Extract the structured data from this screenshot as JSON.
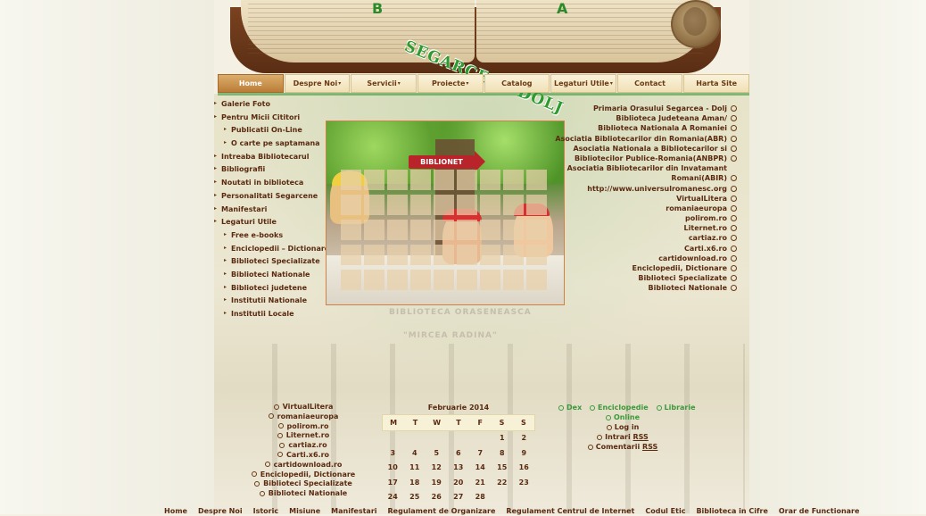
{
  "header": {
    "logo_text": "SEGARCEA - DOLJ",
    "book_left": "B",
    "book_right": "A"
  },
  "nav": [
    {
      "label": "Home",
      "active": true,
      "dropdown": false
    },
    {
      "label": "Despre Noi",
      "active": false,
      "dropdown": true
    },
    {
      "label": "Servicii",
      "active": false,
      "dropdown": true
    },
    {
      "label": "Proiecte",
      "active": false,
      "dropdown": true
    },
    {
      "label": "Catalog",
      "active": false,
      "dropdown": false
    },
    {
      "label": "Legaturi Utile",
      "active": false,
      "dropdown": true
    },
    {
      "label": "Contact",
      "active": false,
      "dropdown": false
    },
    {
      "label": "Harta Site",
      "active": false,
      "dropdown": false
    }
  ],
  "left_menu": [
    {
      "label": "Galerie Foto",
      "sub": false
    },
    {
      "label": "Pentru Micii Cititori",
      "sub": false
    },
    {
      "label": "Publicatii On-Line",
      "sub": true
    },
    {
      "label": "O carte pe saptamana",
      "sub": true
    },
    {
      "label": "Intreaba Bibliotecarul",
      "sub": false
    },
    {
      "label": "Bibliografii",
      "sub": false
    },
    {
      "label": "Noutati in biblioteca",
      "sub": false
    },
    {
      "label": "Personalitati Segarcene",
      "sub": false
    },
    {
      "label": "Manifestari",
      "sub": false
    },
    {
      "label": "Legaturi Utile",
      "sub": false
    },
    {
      "label": "Free e-books",
      "sub": true
    },
    {
      "label": "Enciclopedii – Dictionare",
      "sub": true
    },
    {
      "label": "Biblioteci Specializate",
      "sub": true
    },
    {
      "label": "Biblioteci Nationale",
      "sub": true
    },
    {
      "label": "Biblioteci judetene",
      "sub": true
    },
    {
      "label": "Institutii Nationale",
      "sub": true
    },
    {
      "label": "Institutii Locale",
      "sub": true
    }
  ],
  "photo": {
    "sign_text": "BIBLIONET"
  },
  "watermark": {
    "line1": "BIBLIOTECA ORASENEASCA",
    "line2": "\"MIRCEA RADINA\""
  },
  "right_links": [
    {
      "label": "Primaria Orasului Segarcea - Dolj",
      "bullet": true
    },
    {
      "label": "Biblioteca Judeteana Aman/",
      "bullet": true
    },
    {
      "label": "Biblioteca Nationala A Romaniei",
      "bullet": true
    },
    {
      "label": "Asociatia Bibliotecarilor din Romania(ABR)",
      "bullet": true
    },
    {
      "label": "Asociatia Nationala a Bibliotecarilor si",
      "bullet": true
    },
    {
      "label": "Bibliotecilor Publice-Romania(ANBPR)",
      "bullet": true
    },
    {
      "label": "Asociatia Bibliotecarilor din Invatamant",
      "bullet": false
    },
    {
      "label": "Romani(ABIR)",
      "bullet": true
    },
    {
      "label": "http://www.universulromanesc.org",
      "bullet": true
    },
    {
      "label": "VirtualLitera",
      "bullet": true
    },
    {
      "label": "romaniaeuropa",
      "bullet": true
    },
    {
      "label": "polirom.ro",
      "bullet": true
    },
    {
      "label": "Liternet.ro",
      "bullet": true
    },
    {
      "label": "cartiaz.ro",
      "bullet": true
    },
    {
      "label": "Carti.x6.ro",
      "bullet": true
    },
    {
      "label": "cartidownload.ro",
      "bullet": true
    },
    {
      "label": "Enciclopedii, Dictionare",
      "bullet": true
    },
    {
      "label": "Biblioteci Specializate",
      "bullet": true
    },
    {
      "label": "Biblioteci Nationale",
      "bullet": true
    }
  ],
  "bottom_list": [
    "VirtualLitera",
    "romaniaeuropa",
    "polirom.ro",
    "Liternet.ro",
    "cartiaz.ro",
    "Carti.x6.ro",
    "cartidownload.ro",
    "Enciclopedii, Dictionare",
    "Biblioteci Specializate",
    "Biblioteci Nationale"
  ],
  "calendar": {
    "title": "Februarie 2014",
    "days": [
      "M",
      "T",
      "W",
      "T",
      "F",
      "S",
      "S"
    ],
    "weeks": [
      [
        "",
        "",
        "",
        "",
        "",
        "1",
        "2"
      ],
      [
        "3",
        "4",
        "5",
        "6",
        "7",
        "8",
        "9"
      ],
      [
        "10",
        "11",
        "12",
        "13",
        "14",
        "15",
        "16"
      ],
      [
        "17",
        "18",
        "19",
        "20",
        "21",
        "22",
        "23"
      ],
      [
        "24",
        "25",
        "26",
        "27",
        "28",
        "",
        ""
      ]
    ]
  },
  "bottom_right": {
    "dex": "Dex",
    "enciclopedie": "Enciclopedie",
    "librarie": "Librarie",
    "online": "Online",
    "login": "Log in",
    "intrari_prefix": "Intrari ",
    "intrari_rss": "RSS",
    "comentarii_prefix": "Comentarii ",
    "comentarii_rss": "RSS"
  },
  "footer": [
    "Home",
    "Despre Noi",
    "Istoric",
    "Misiune",
    "Manifestari",
    "Regulament de Organizare",
    "Regulament Centrul de Internet",
    "Codul Etic",
    "Biblioteca in Cifre",
    "Orar de Functionare"
  ],
  "colors": {
    "text_brown": "#5a2a10",
    "accent_green": "#3a9a3a",
    "nav_active": "#b97d38"
  }
}
